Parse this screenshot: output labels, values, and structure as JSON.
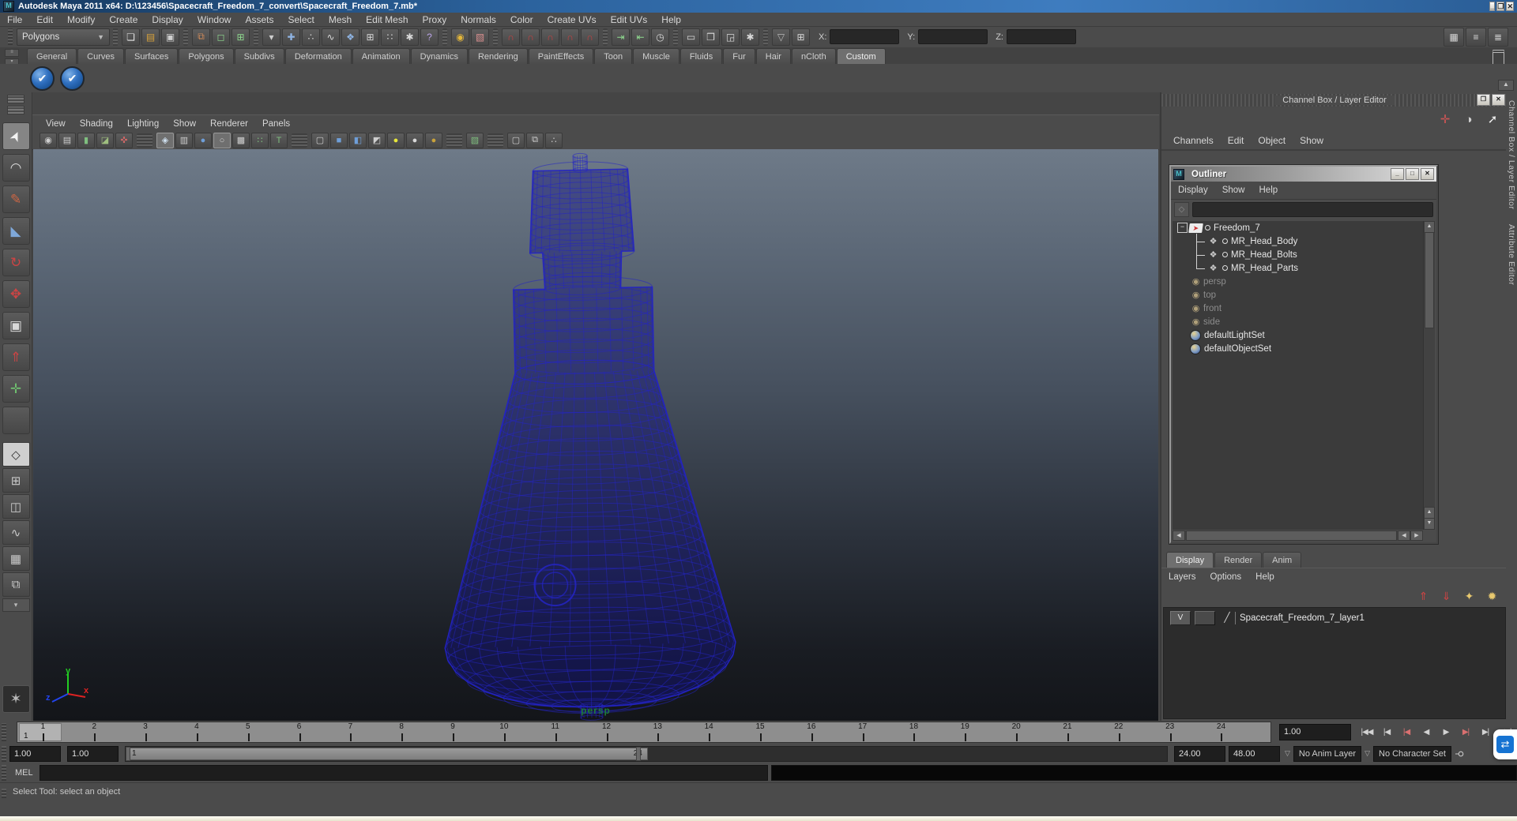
{
  "window": {
    "title": "Autodesk Maya 2011 x64: D:\\123456\\Spacecraft_Freedom_7_convert\\Spacecraft_Freedom_7.mb*",
    "controls": [
      {
        "name": "minimize-button",
        "glyph": "_"
      },
      {
        "name": "maximize-button",
        "glyph": "❐"
      },
      {
        "name": "close-button",
        "glyph": "✕"
      }
    ]
  },
  "menu_bar": {
    "items": [
      "File",
      "Edit",
      "Modify",
      "Create",
      "Display",
      "Window",
      "Assets",
      "Select",
      "Mesh",
      "Edit Mesh",
      "Proxy",
      "Normals",
      "Color",
      "Create UVs",
      "Edit UVs",
      "Help"
    ]
  },
  "status_line": {
    "mode_selector": "Polygons",
    "icons": [
      {
        "name": "new-scene-icon",
        "glyph": "❏",
        "c": "#e6e6e6"
      },
      {
        "name": "open-scene-icon",
        "glyph": "▤",
        "c": "#d9a33b"
      },
      {
        "name": "save-scene-icon",
        "glyph": "▣",
        "c": "#cfcfcf"
      },
      {
        "sep": true
      },
      {
        "name": "select-hierarchy-icon",
        "glyph": "⧉",
        "c": "#cf8a5a"
      },
      {
        "name": "select-object-icon",
        "glyph": "◻",
        "c": "#8fd98f"
      },
      {
        "name": "select-component-icon",
        "glyph": "⊞",
        "c": "#8fd98f"
      },
      {
        "sep": true
      },
      {
        "name": "selection-mask-arrow-icon",
        "glyph": "▾",
        "c": "#cfcfcf"
      },
      {
        "name": "snap-grid-cross-icon",
        "glyph": "✚",
        "c": "#8fb4e3"
      },
      {
        "name": "snap-point-icon",
        "glyph": "∴",
        "c": "#d9d9d9"
      },
      {
        "name": "snap-curve-icon",
        "glyph": "∿",
        "c": "#d9d9d9"
      },
      {
        "name": "snap-view-plane-icon",
        "glyph": "❖",
        "c": "#8fb4e3"
      },
      {
        "name": "make-live-icon",
        "glyph": "⊞",
        "c": "#d9d9d9"
      },
      {
        "name": "snap-center-icon",
        "glyph": "∷",
        "c": "#d9d9d9"
      },
      {
        "name": "snap-release-icon",
        "glyph": "✱",
        "c": "#d9d9d9"
      },
      {
        "name": "help-mode-icon",
        "glyph": "?",
        "c": "#b9a3e6"
      },
      {
        "sep": true
      },
      {
        "name": "lock-selection-icon",
        "glyph": "◉",
        "c": "#e3b63a"
      },
      {
        "name": "highlight-selection-icon",
        "glyph": "▧",
        "c": "#d98f8f"
      },
      {
        "sep": true
      },
      {
        "name": "snap-to-grids-magnet-icon",
        "glyph": "∩",
        "c": "#cc4040"
      },
      {
        "name": "snap-to-curves-magnet-icon",
        "glyph": "∩",
        "c": "#cc4040"
      },
      {
        "name": "snap-to-points-magnet-icon",
        "glyph": "∩",
        "c": "#cc4040"
      },
      {
        "name": "snap-to-planes-magnet-icon",
        "glyph": "∩",
        "c": "#cc4040"
      },
      {
        "name": "snap-to-live-magnet-icon",
        "glyph": "∩",
        "c": "#cc4040"
      },
      {
        "sep": true
      },
      {
        "name": "input-connections-icon",
        "glyph": "⇥",
        "c": "#8fd98f"
      },
      {
        "name": "output-connections-icon",
        "glyph": "⇤",
        "c": "#8fd98f"
      },
      {
        "name": "construction-history-icon",
        "glyph": "◷",
        "c": "#d9d9d9"
      },
      {
        "sep": true
      },
      {
        "name": "render-view-icon",
        "glyph": "▭",
        "c": "#d9d9d9"
      },
      {
        "name": "render-current-frame-icon",
        "glyph": "❒",
        "c": "#d9d9d9"
      },
      {
        "name": "ipr-render-icon",
        "glyph": "◲",
        "c": "#d9d9d9"
      },
      {
        "name": "render-settings-icon",
        "glyph": "✱",
        "c": "#d9d9d9"
      },
      {
        "sep": true
      },
      {
        "name": "quick-rename-arrow-icon",
        "glyph": "▽",
        "c": "#b9b9b9"
      },
      {
        "name": "absolute-mode-icon",
        "glyph": "⊞",
        "c": "#d9d9d9"
      }
    ],
    "coords": {
      "x_label": "X:",
      "y_label": "Y:",
      "z_label": "Z:",
      "x_value": "",
      "y_value": "",
      "z_value": ""
    },
    "right_buttons": [
      {
        "name": "channel-box-toggle-icon",
        "glyph": "▦",
        "c": "#d9d9d9"
      },
      {
        "name": "tool-settings-toggle-icon",
        "glyph": "≡",
        "c": "#d9d9d9"
      },
      {
        "name": "attribute-editor-toggle-icon",
        "glyph": "≣",
        "c": "#d9d9d9"
      }
    ]
  },
  "shelf": {
    "tabs": [
      {
        "label": "General"
      },
      {
        "label": "Curves"
      },
      {
        "label": "Surfaces"
      },
      {
        "label": "Polygons"
      },
      {
        "label": "Subdivs"
      },
      {
        "label": "Deformation"
      },
      {
        "label": "Animation"
      },
      {
        "label": "Dynamics"
      },
      {
        "label": "Rendering"
      },
      {
        "label": "PaintEffects"
      },
      {
        "label": "Toon"
      },
      {
        "label": "Muscle"
      },
      {
        "label": "Fluids"
      },
      {
        "label": "Fur"
      },
      {
        "label": "Hair"
      },
      {
        "label": "nCloth"
      },
      {
        "label": "Custom",
        "active": true
      }
    ],
    "items": [
      {
        "name": "shelf-smooth-button-1",
        "glyph": "✔"
      },
      {
        "name": "shelf-smooth-button-2",
        "glyph": "✔"
      }
    ]
  },
  "toolbox": {
    "tools": [
      {
        "name": "select-tool",
        "glyph": "➤",
        "c": "#f2f2f2",
        "active": true,
        "rot": true
      },
      {
        "name": "lasso-tool",
        "glyph": "◠",
        "c": "#d8d8d8"
      },
      {
        "name": "paint-selection-tool",
        "glyph": "✎",
        "c": "#cc6644"
      },
      {
        "name": "move-tool",
        "glyph": "◣",
        "c": "#7fa8d9"
      },
      {
        "name": "rotate-tool",
        "glyph": "↻",
        "c": "#cc4444"
      },
      {
        "name": "scale-tool",
        "glyph": "✥",
        "c": "#cc4444"
      },
      {
        "name": "universal-manipulator-tool",
        "glyph": "▣",
        "c": "#d8d8d8"
      },
      {
        "name": "soft-modification-tool",
        "glyph": "⇑",
        "c": "#cc4444"
      },
      {
        "name": "show-manipulator-tool",
        "glyph": "✛",
        "c": "#6fbf6f"
      },
      {
        "name": "last-tool-slot",
        "glyph": "",
        "c": "#888888"
      }
    ],
    "layouts": [
      {
        "name": "layout-single-perspective",
        "glyph": "◇",
        "active": true
      },
      {
        "name": "layout-four-view",
        "glyph": "⊞"
      },
      {
        "name": "layout-outliner-persp",
        "glyph": "◫"
      },
      {
        "name": "layout-persp-graph",
        "glyph": "∿"
      },
      {
        "name": "layout-hypershade-persp",
        "glyph": "▦"
      },
      {
        "name": "layout-persp-hypergraph",
        "glyph": "⧉"
      }
    ],
    "layouts_more_glyph": "▾",
    "mascot_glyph": "✶"
  },
  "viewport": {
    "menu": [
      "View",
      "Shading",
      "Lighting",
      "Show",
      "Renderer",
      "Panels"
    ],
    "icons": [
      {
        "name": "perspective-camera-icon",
        "glyph": "◉",
        "c": "#cfcfcf"
      },
      {
        "name": "camera-attributes-icon",
        "glyph": "▤",
        "c": "#cfcfcf"
      },
      {
        "name": "bookmark-icon",
        "glyph": "▮",
        "c": "#7fbf7f"
      },
      {
        "name": "image-plane-icon",
        "glyph": "◪",
        "c": "#9fbf7f"
      },
      {
        "name": "pan-zoom-icon",
        "glyph": "✜",
        "c": "#cc6666"
      },
      {
        "sep": true
      },
      {
        "name": "wireframe-mode-icon",
        "glyph": "◈",
        "c": "#cfe0ef",
        "pressed": true
      },
      {
        "name": "film-gate-icon",
        "glyph": "▥",
        "c": "#cfcfcf"
      },
      {
        "name": "shaded-mode-icon",
        "glyph": "●",
        "c": "#6f9fd9"
      },
      {
        "name": "resolution-gate-icon",
        "glyph": "○",
        "c": "#cfcfcf",
        "pressed": true
      },
      {
        "name": "gate-mask-icon",
        "glyph": "▩",
        "c": "#cfcfcf"
      },
      {
        "name": "field-chart-icon",
        "glyph": "∷",
        "c": "#7fbf7f"
      },
      {
        "name": "safe-title-icon",
        "glyph": "T",
        "c": "#7fbf7f"
      },
      {
        "sep": true
      },
      {
        "name": "wireframe-on-shaded-icon",
        "glyph": "▢",
        "c": "#cfcfcf"
      },
      {
        "name": "default-material-icon",
        "glyph": "■",
        "c": "#6f9fd9"
      },
      {
        "name": "textured-mode-icon",
        "glyph": "◧",
        "c": "#6f9fd9"
      },
      {
        "name": "use-all-lights-icon",
        "glyph": "◩",
        "c": "#cfcfcf"
      },
      {
        "name": "ambient-light-icon",
        "glyph": "●",
        "c": "#e8e83a"
      },
      {
        "name": "flat-light-icon",
        "glyph": "●",
        "c": "#d9d9d9"
      },
      {
        "name": "no-lights-icon",
        "glyph": "●",
        "c": "#c9a23a"
      },
      {
        "sep": true
      },
      {
        "name": "isolate-select-icon",
        "glyph": "▧",
        "c": "#7fbf7f"
      },
      {
        "sep": true
      },
      {
        "name": "xray-icon",
        "glyph": "▢",
        "c": "#cfcfcf"
      },
      {
        "name": "xray-active-icon",
        "glyph": "⧉",
        "c": "#cfcfcf"
      },
      {
        "name": "plugin-shapes-icon",
        "glyph": "∴",
        "c": "#cfcfcf"
      }
    ],
    "camera_label": "persp",
    "axis": {
      "x": "x",
      "y": "y",
      "z": "z"
    }
  },
  "channel_box": {
    "header": "Channel Box / Layer Editor",
    "window_buttons": [
      {
        "name": "panel-float-button",
        "glyph": "❐"
      },
      {
        "name": "panel-close-button",
        "glyph": "✕"
      }
    ],
    "tool_icons": [
      {
        "name": "manipulator-axis-icon",
        "glyph": "✛",
        "c": "#cc5555"
      },
      {
        "name": "speed-state-icon",
        "glyph": "◑",
        "c": "#cfcfcf"
      },
      {
        "name": "select-arrow-icon",
        "glyph": "➚",
        "c": "#ececec"
      }
    ],
    "menu": [
      "Channels",
      "Edit",
      "Object",
      "Show"
    ],
    "side_tabs": [
      "Channel Box / Layer Editor",
      "Attribute Editor"
    ]
  },
  "outliner": {
    "title": "Outliner",
    "window_buttons": [
      {
        "name": "outliner-minimize-button",
        "glyph": "_"
      },
      {
        "name": "outliner-maximize-button",
        "glyph": "□"
      },
      {
        "name": "outliner-close-button",
        "glyph": "✕"
      }
    ],
    "menu": [
      "Display",
      "Show",
      "Help"
    ],
    "search_value": "",
    "tree": [
      {
        "label": "Freedom_7",
        "icon": "group-icon",
        "g": "➤",
        "root": true,
        "tnode": true,
        "exp": "−"
      },
      {
        "label": "MR_Head_Body",
        "icon": "mesh-icon",
        "g": "❖",
        "c": "#c9c9c9",
        "child": true,
        "tnode": true
      },
      {
        "label": "MR_Head_Bolts",
        "icon": "mesh-icon",
        "g": "❖",
        "c": "#c9c9c9",
        "child": true,
        "tnode": true
      },
      {
        "label": "MR_Head_Parts",
        "icon": "mesh-icon",
        "g": "❖",
        "c": "#c9c9c9",
        "child": true,
        "last": true,
        "tnode": true
      },
      {
        "label": "persp",
        "icon": "camera-icon",
        "g": "◉",
        "c": "#b0a07a",
        "muted": true
      },
      {
        "label": "top",
        "icon": "camera-icon",
        "g": "◉",
        "c": "#b0a07a",
        "muted": true
      },
      {
        "label": "front",
        "icon": "camera-icon",
        "g": "◉",
        "c": "#b0a07a",
        "muted": true
      },
      {
        "label": "side",
        "icon": "camera-icon",
        "g": "◉",
        "c": "#b0a07a",
        "muted": true
      },
      {
        "label": "defaultLightSet",
        "icon": "set-icon",
        "g": "",
        "ball": true
      },
      {
        "label": "defaultObjectSet",
        "icon": "set-icon",
        "g": "",
        "ball": true
      }
    ]
  },
  "layer_editor": {
    "tabs": [
      {
        "label": "Display",
        "active": true
      },
      {
        "label": "Render"
      },
      {
        "label": "Anim"
      }
    ],
    "menu": [
      "Layers",
      "Options",
      "Help"
    ],
    "buttons": [
      {
        "name": "move-layer-up-icon",
        "glyph": "⇑",
        "c": "#cc4444"
      },
      {
        "name": "move-layer-down-icon",
        "glyph": "⇓",
        "c": "#cc4444"
      },
      {
        "name": "new-empty-layer-icon",
        "glyph": "✦",
        "c": "#e8c96f"
      },
      {
        "name": "new-layer-from-selected-icon",
        "glyph": "✹",
        "c": "#e8c96f"
      }
    ],
    "layers": [
      {
        "visibility": "V",
        "type_glyph": "╱",
        "label": "Spacecraft_Freedom_7_layer1"
      }
    ]
  },
  "timeline": {
    "frames": [
      "1",
      "2",
      "3",
      "4",
      "5",
      "6",
      "7",
      "8",
      "9",
      "10",
      "11",
      "12",
      "13",
      "14",
      "15",
      "16",
      "17",
      "18",
      "19",
      "20",
      "21",
      "22",
      "23",
      "24"
    ],
    "current_frame": "1",
    "current_time": "1.00",
    "playback": [
      {
        "name": "go-to-start-button",
        "glyph": "|◀◀"
      },
      {
        "name": "step-back-frame-button",
        "glyph": "|◀"
      },
      {
        "name": "step-back-key-button",
        "glyph": "|◀",
        "red": true
      },
      {
        "name": "play-backwards-button",
        "glyph": "◀"
      },
      {
        "name": "play-forwards-button",
        "glyph": "▶"
      },
      {
        "name": "step-forward-key-button",
        "glyph": "▶|",
        "red": true
      },
      {
        "name": "step-forward-frame-button",
        "glyph": "▶|"
      },
      {
        "name": "go-to-end-button",
        "glyph": "▶▶|"
      }
    ]
  },
  "range_slider": {
    "anim_start": "1.00",
    "playback_start": "1.00",
    "range_start_label": "1",
    "range_end_label": "24",
    "playback_end": "24.00",
    "anim_end": "48.00",
    "anim_layer": "No Anim Layer",
    "character_set": "No Character Set",
    "key_glyph": "⚲"
  },
  "command_line": {
    "label": "MEL",
    "value": "",
    "output": ""
  },
  "help_line": {
    "text": "Select Tool: select an object"
  },
  "overlay": {
    "teamviewer_glyph": "⇄"
  },
  "colors": {
    "wireframe": "#2424c4",
    "wireframe_fill": "rgba(16,16,130,0.42)",
    "persp_label": "#1e7a3c",
    "axis_x": "#dd2222",
    "axis_y": "#22cc22",
    "axis_z": "#2244ee"
  }
}
